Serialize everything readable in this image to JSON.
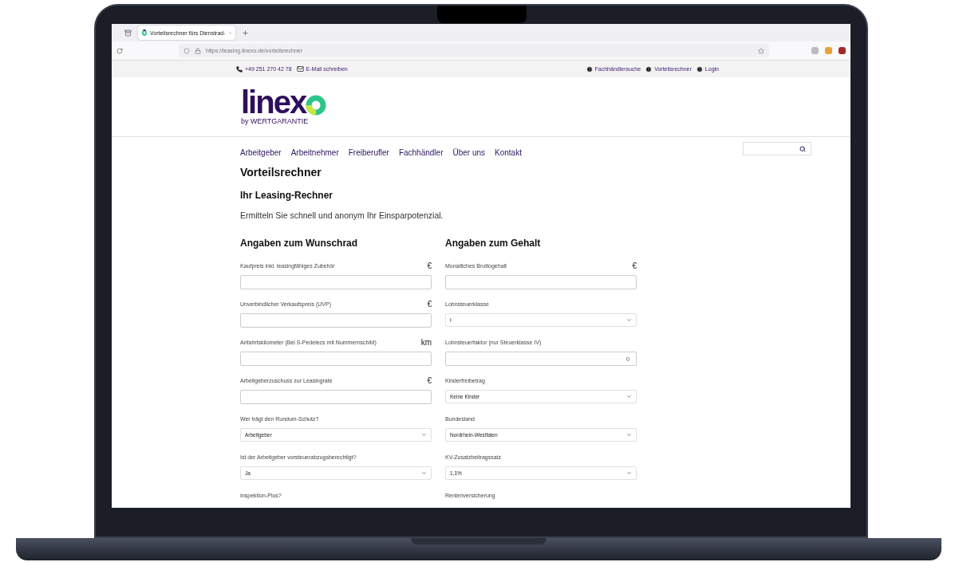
{
  "browser": {
    "tab": {
      "title": "Vorteilsrechner fürs Dienstrad-",
      "selected": true
    },
    "url": "https://leasing.linexo.de/vorteilsrechner"
  },
  "topbar": {
    "phone": "+49 251 270 42 78",
    "email": "E-Mail schreiben",
    "links": [
      "Fachhändlersuche",
      "Vorteilsrechner",
      "Login"
    ]
  },
  "logo": {
    "word": "linex",
    "tagline": "by WERTGARANTIE"
  },
  "nav": [
    "Arbeitgeber",
    "Arbeitnehmer",
    "Freiberufler",
    "Fachhändler",
    "Über uns",
    "Kontakt"
  ],
  "page": {
    "title": "Vorteilsrechner",
    "subtitle": "Ihr Leasing-Rechner",
    "intro": "Ermitteln Sie schnell und anonym Ihr Einsparpotenzial."
  },
  "columns": [
    {
      "heading": "Angaben zum Wunschrad",
      "fields": [
        {
          "kind": "input",
          "label": "Kaufpreis inkl. leasingfähiges Zubehör",
          "unit": "€"
        },
        {
          "kind": "input",
          "label": "Unverbindlicher Verkaufspreis (UVP)",
          "unit": "€"
        },
        {
          "kind": "input",
          "label": "Anfahrtskilometer (Bei S-Pedelecs mit Nummernschild)",
          "unit": "km"
        },
        {
          "kind": "input",
          "label": "Arbeitgeberzuschuss zur Leasingrate",
          "unit": "€"
        },
        {
          "kind": "select",
          "label": "Wer trägt den Rundum-Schutz?",
          "value": "Arbeitgeber"
        },
        {
          "kind": "select",
          "label": "Ist der Arbeitgeber vorsteuerabzugsberechtigt?",
          "value": "Ja"
        },
        {
          "kind": "label",
          "label": "Inspektion-Plus?"
        }
      ]
    },
    {
      "heading": "Angaben zum Gehalt",
      "fields": [
        {
          "kind": "input",
          "label": "Monatliches Bruttogehalt",
          "unit": "€"
        },
        {
          "kind": "select",
          "label": "Lohnsteuerklasse",
          "value": "I"
        },
        {
          "kind": "input",
          "label": "Lohnsteuerfaktor (nur Steuerklasse IV)",
          "value": "0"
        },
        {
          "kind": "select",
          "label": "Kinderfreibetrag",
          "value": "Keine Kinder"
        },
        {
          "kind": "select",
          "label": "Bundesland",
          "value": "Nordrhein-Westfalen"
        },
        {
          "kind": "select",
          "label": "KV-Zusatzbeitragssatz",
          "value": "1,1%"
        },
        {
          "kind": "label",
          "label": "Rentenversicherung"
        }
      ]
    }
  ]
}
